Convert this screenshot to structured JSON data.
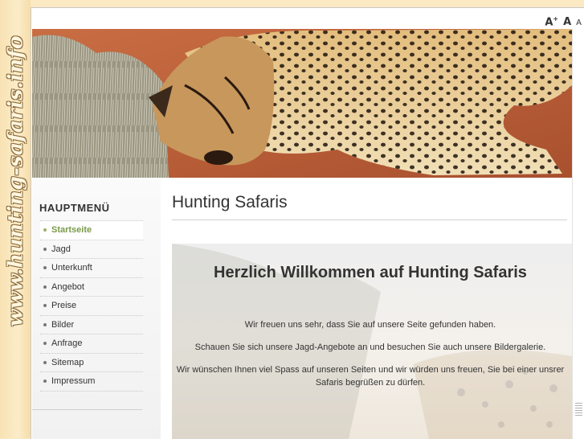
{
  "site": {
    "vertical_name": "www.hunting-safaris.info"
  },
  "fontsize": {
    "increase": "A",
    "increase_sup": "+",
    "normal": "A",
    "decrease": "A"
  },
  "sidebar": {
    "title": "HAUPTMENÜ",
    "items": [
      {
        "label": "Startseite",
        "active": true
      },
      {
        "label": "Jagd"
      },
      {
        "label": "Unterkunft"
      },
      {
        "label": "Angebot"
      },
      {
        "label": "Preise"
      },
      {
        "label": "Bilder"
      },
      {
        "label": "Anfrage"
      },
      {
        "label": "Sitemap"
      },
      {
        "label": "Impressum"
      }
    ]
  },
  "main": {
    "title": "Hunting Safaris",
    "welcome": "Herzlich Willkommen auf Hunting Safaris",
    "paragraphs": [
      "Wir freuen uns sehr, dass Sie auf unsere Seite gefunden haben.",
      "Schauen Sie sich unsere Jagd-Angebote an und besuchen Sie auch unsere Bildergalerie.",
      "Wir wünschen Ihnen viel Spass auf unseren Seiten und wir würden uns freuen, Sie bei einer unsrer Safaris begrüßen zu dürfen."
    ]
  },
  "colors": {
    "accent": "#7a9a4a",
    "background": "#fbe9c4",
    "text": "#333333"
  }
}
